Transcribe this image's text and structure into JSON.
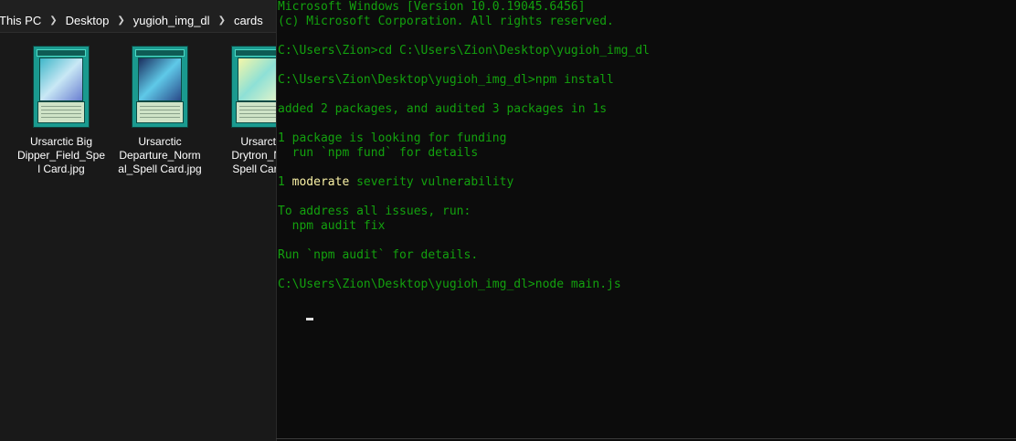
{
  "explorer": {
    "breadcrumb": [
      "This PC",
      "Desktop",
      "yugioh_img_dl",
      "cards"
    ],
    "files": [
      {
        "name": "Ursarctic Big Dipper_Field_Spell Card.jpg",
        "lines": [
          "Ursarctic Big",
          "Dipper_Field_Spe",
          "l Card.jpg"
        ],
        "art_colors": [
          "#3fb7c9",
          "#c9e8f5",
          "#6a7fd1"
        ]
      },
      {
        "name": "Ursarctic Departure_Normal_Spell Card.jpg",
        "lines": [
          "Ursarctic",
          "Departure_Norm",
          "al_Spell Card.jpg"
        ],
        "art_colors": [
          "#1b2f5f",
          "#5fc9e8",
          "#2a4a8a"
        ]
      },
      {
        "name": "Ursarctic Drytron_Normal_Spell Card.jpg",
        "lines": [
          "Ursarcti",
          "Drytron_No",
          "Spell Card."
        ],
        "art_colors": [
          "#f5f7a8",
          "#8ee0d6",
          "#e8f5c9"
        ]
      }
    ]
  },
  "terminal": {
    "lines": [
      "Microsoft Windows [Version 10.0.19045.6456]",
      "(c) Microsoft Corporation. All rights reserved.",
      "",
      "C:\\Users\\Zion>cd C:\\Users\\Zion\\Desktop\\yugioh_img_dl",
      "",
      "C:\\Users\\Zion\\Desktop\\yugioh_img_dl>npm install",
      "",
      "added 2 packages, and audited 3 packages in 1s",
      "",
      "1 package is looking for funding",
      "  run `npm fund` for details",
      "",
      "1 moderate severity vulnerability",
      "",
      "To address all issues, run:",
      "  npm audit fix",
      "",
      "Run `npm audit` for details.",
      "",
      "C:\\Users\\Zion\\Desktop\\yugioh_img_dl>node main.js"
    ],
    "highlight_word": "moderate",
    "colors": {
      "text": "#13a10e",
      "highlight": "#f9f1a5",
      "background": "#0c0c0c"
    }
  }
}
